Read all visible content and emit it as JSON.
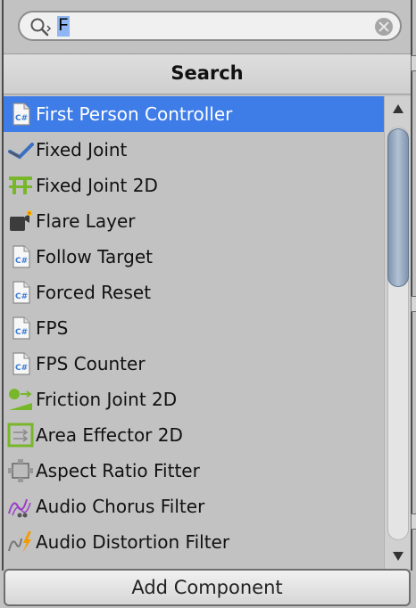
{
  "search": {
    "value": "F"
  },
  "header": {
    "title": "Search"
  },
  "items": [
    {
      "label": "First Person Controller",
      "icon": "csharp-script-icon",
      "selected": true
    },
    {
      "label": "Fixed Joint",
      "icon": "fixed-joint-icon",
      "selected": false
    },
    {
      "label": "Fixed Joint 2D",
      "icon": "fixed-joint-2d-icon",
      "selected": false
    },
    {
      "label": "Flare Layer",
      "icon": "flare-layer-icon",
      "selected": false
    },
    {
      "label": "Follow Target",
      "icon": "csharp-script-icon",
      "selected": false
    },
    {
      "label": "Forced Reset",
      "icon": "csharp-script-icon",
      "selected": false
    },
    {
      "label": "FPS",
      "icon": "csharp-script-icon",
      "selected": false
    },
    {
      "label": "FPS Counter",
      "icon": "csharp-script-icon",
      "selected": false
    },
    {
      "label": "Friction Joint 2D",
      "icon": "friction-joint-2d-icon",
      "selected": false
    },
    {
      "label": "Area Effector 2D",
      "icon": "area-effector-2d-icon",
      "selected": false
    },
    {
      "label": "Aspect Ratio Fitter",
      "icon": "aspect-ratio-fitter-icon",
      "selected": false
    },
    {
      "label": "Audio Chorus Filter",
      "icon": "audio-chorus-filter-icon",
      "selected": false
    },
    {
      "label": "Audio Distortion Filter",
      "icon": "audio-distortion-filter-icon",
      "selected": false
    }
  ],
  "footer": {
    "add_component_label": "Add Component"
  },
  "colors": {
    "selection": "#3e7ce8",
    "background": "#c2c2c2"
  }
}
